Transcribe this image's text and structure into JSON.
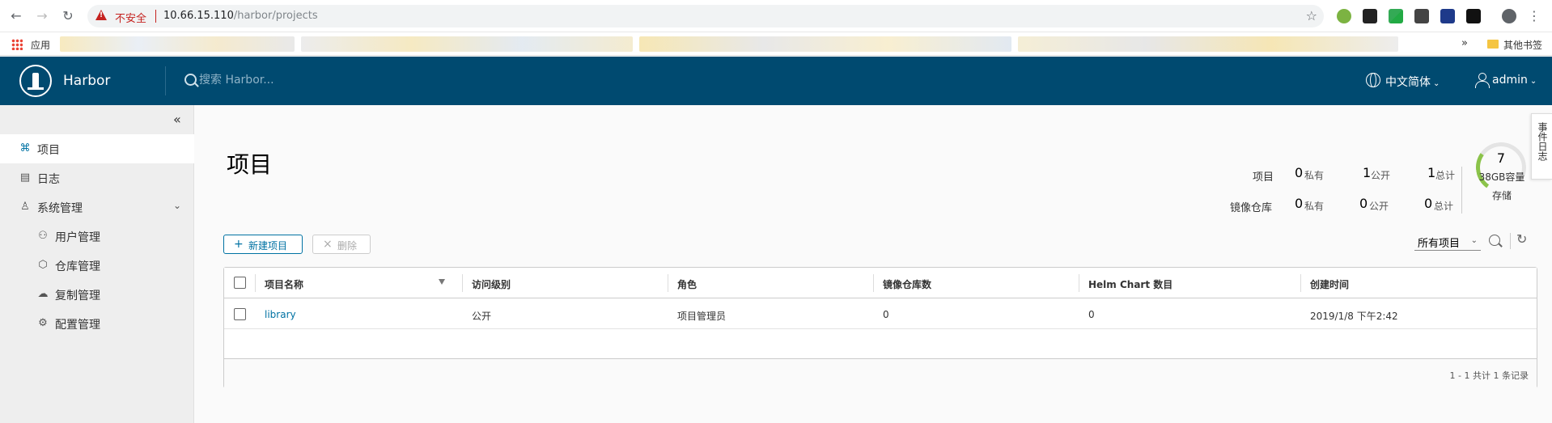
{
  "browser": {
    "insecure_label": "不安全",
    "url_host": "10.66.15.110",
    "url_path": "/harbor/projects",
    "apps_label": "应用",
    "more_label": "»",
    "other_bookmarks": "其他书签"
  },
  "header": {
    "brand": "Harbor",
    "search_placeholder": "搜索 Harbor...",
    "language": "中文简体",
    "user": "admin"
  },
  "sidebar": {
    "items": [
      {
        "label": "项目"
      },
      {
        "label": "日志"
      },
      {
        "label": "系统管理"
      },
      {
        "label": "用户管理"
      },
      {
        "label": "仓库管理"
      },
      {
        "label": "复制管理"
      },
      {
        "label": "配置管理"
      }
    ]
  },
  "page": {
    "title": "项目",
    "side_tab": "事件日志"
  },
  "stats": {
    "projects_label": "项目",
    "repos_label": "镜像仓库",
    "private_label": "私有",
    "public_label": "公开",
    "total_label": "总计",
    "projects_private": "0",
    "projects_public": "1",
    "projects_total": "1",
    "repos_private": "0",
    "repos_public": "0",
    "repos_total": "0",
    "capacity_num": "7",
    "capacity_label": "38GB容量",
    "storage_label": "存储"
  },
  "toolbar": {
    "new_project": "新建项目",
    "delete": "删除",
    "filter_value": "所有项目"
  },
  "table": {
    "columns": [
      "项目名称",
      "访问级别",
      "角色",
      "镜像仓库数",
      "Helm Chart 数目",
      "创建时间"
    ],
    "rows": [
      {
        "name": "library",
        "access": "公开",
        "role": "项目管理员",
        "repos": "0",
        "charts": "0",
        "created": "2019/1/8 下午2:42"
      }
    ],
    "footer": "1 - 1 共计 1 条记录"
  }
}
